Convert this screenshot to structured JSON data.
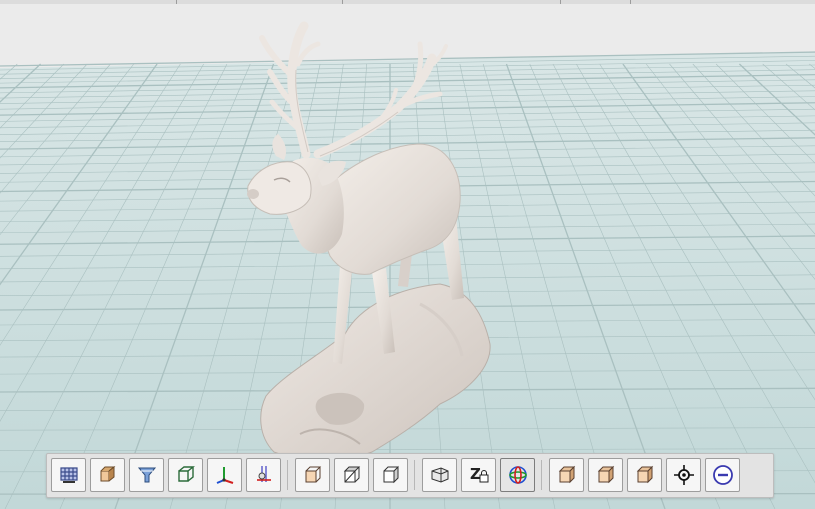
{
  "viewer": {
    "background_color": "#ebebeb",
    "floor_color": "#c7dcdc",
    "grid_line_color": "#a9c0c0",
    "model": {
      "name": "deer-statue",
      "color": "#ece6e1"
    }
  },
  "toolbar": {
    "groups": [
      [
        {
          "name": "wireframe-view-button",
          "icon": "mesh-grid-icon",
          "pressed": false
        },
        {
          "name": "shaded-view-button",
          "icon": "shaded-cube-icon",
          "pressed": false
        },
        {
          "name": "filter-view-button",
          "icon": "funnel-icon",
          "pressed": false
        },
        {
          "name": "bounding-box-button",
          "icon": "box-outline-icon",
          "pressed": false
        },
        {
          "name": "axes-toggle-button",
          "icon": "xyz-axes-icon",
          "pressed": false
        },
        {
          "name": "measure-tool-button",
          "icon": "ruler-icon",
          "pressed": false
        }
      ],
      [
        {
          "name": "front-view-button",
          "icon": "cube-front-icon",
          "pressed": false
        },
        {
          "name": "top-view-button",
          "icon": "cube-top-icon",
          "pressed": false
        },
        {
          "name": "side-view-button",
          "icon": "cube-side-icon",
          "pressed": false
        }
      ],
      [
        {
          "name": "perspective-toggle-button",
          "icon": "perspective-icon",
          "pressed": false
        },
        {
          "name": "z-lock-button",
          "icon": "z-lock-icon",
          "pressed": false
        },
        {
          "name": "orbit-gizmo-button",
          "icon": "orbit-sphere-icon",
          "pressed": true
        }
      ],
      [
        {
          "name": "view-preset-1-button",
          "icon": "cube-icon",
          "pressed": false
        },
        {
          "name": "view-preset-2-button",
          "icon": "cube-icon",
          "pressed": false
        },
        {
          "name": "view-preset-3-button",
          "icon": "cube-icon",
          "pressed": false
        },
        {
          "name": "center-view-button",
          "icon": "crosshair-icon",
          "pressed": false
        },
        {
          "name": "zoom-out-button",
          "icon": "minus-circle-icon",
          "pressed": false
        }
      ]
    ]
  }
}
